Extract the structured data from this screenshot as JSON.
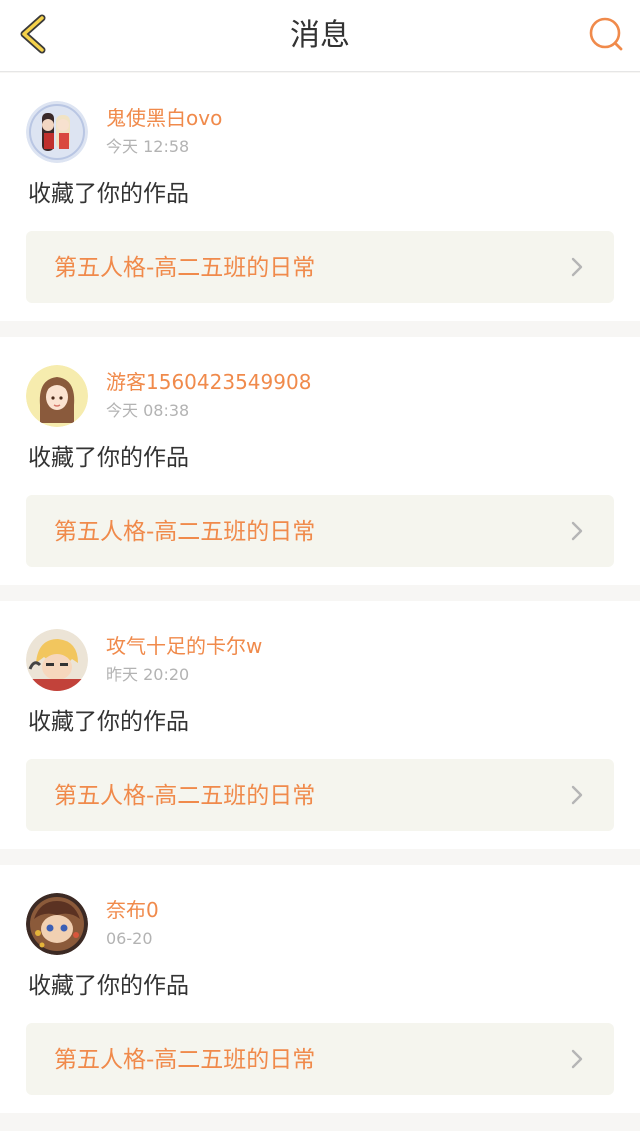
{
  "header": {
    "title": "消息",
    "back_icon": "back-chevron-icon",
    "search_icon": "search-icon",
    "accent_color": "#f08a4b"
  },
  "notifications": [
    {
      "username": "鬼使黑白ovo",
      "time": "今天 12:58",
      "action": "收藏了你的作品",
      "work_title": "第五人格-高二五班的日常"
    },
    {
      "username": "游客1560423549908",
      "time": "今天 08:38",
      "action": "收藏了你的作品",
      "work_title": "第五人格-高二五班的日常"
    },
    {
      "username": "攻气十足的卡尔w",
      "time": "昨天 20:20",
      "action": "收藏了你的作品",
      "work_title": "第五人格-高二五班的日常"
    },
    {
      "username": "奈布0",
      "time": "06-20",
      "action": "收藏了你的作品",
      "work_title": "第五人格-高二五班的日常"
    }
  ]
}
